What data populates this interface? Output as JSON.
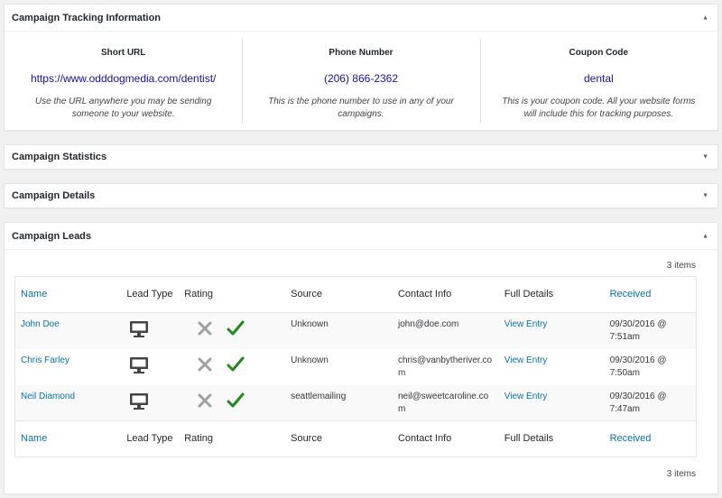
{
  "tracking": {
    "title": "Campaign Tracking Information",
    "columns": [
      {
        "heading": "Short URL",
        "value": "https://www.odddogmedia.com/dentist/",
        "description": "Use the URL anywhere you may be sending someone to your website."
      },
      {
        "heading": "Phone Number",
        "value": "(206) 866-2362",
        "description": "This is the phone number to use in any of your campaigns."
      },
      {
        "heading": "Coupon Code",
        "value": "dental",
        "description": "This is your coupon code. All your website forms will include this for tracking purposes."
      }
    ]
  },
  "stats": {
    "title": "Campaign Statistics"
  },
  "details": {
    "title": "Campaign Details"
  },
  "leads": {
    "title": "Campaign Leads",
    "count": "3 items",
    "columns": {
      "name": "Name",
      "lead_type": "Lead Type",
      "rating": "Rating",
      "source": "Source",
      "contact": "Contact Info",
      "full_details": "Full Details",
      "received": "Received"
    },
    "rows": [
      {
        "name": "John Doe",
        "source": "Unknown",
        "contact": "john@doe.com",
        "details_link": "View Entry",
        "received": "09/30/2016 @ 7:51am"
      },
      {
        "name": "Chris Farley",
        "source": "Unknown",
        "contact": "chris@vanbytheriver.com",
        "details_link": "View Entry",
        "received": "09/30/2016 @ 7:50am"
      },
      {
        "name": "Neil Diamond",
        "source": "seattlemailing",
        "contact": "neil@sweetcaroline.com",
        "details_link": "View Entry",
        "received": "09/30/2016 @ 7:47am"
      }
    ]
  },
  "icons": {
    "collapse": "arrow-up-icon",
    "expand": "arrow-down-icon",
    "lead_type": "desktop-monitor-icon",
    "reject": "x-icon",
    "approve": "checkmark-icon"
  },
  "colors": {
    "link": "#0073aa",
    "tracking_link": "#1a0dab",
    "approve": "#1e8a1e",
    "reject": "#a0a0a0"
  }
}
